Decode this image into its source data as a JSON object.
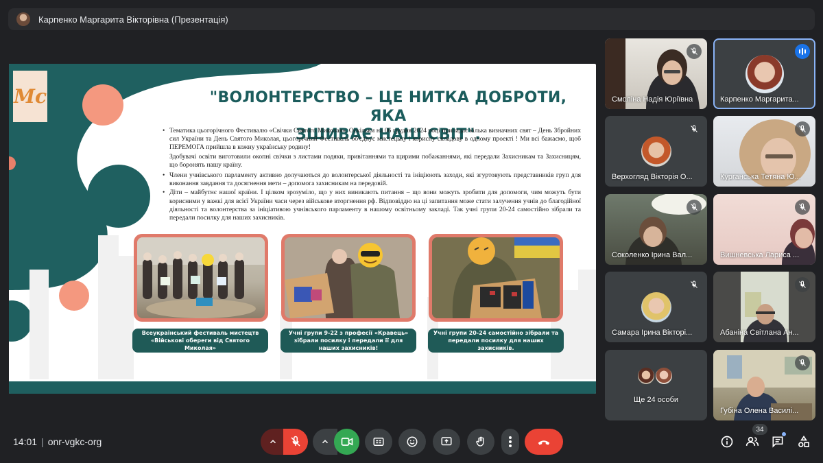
{
  "presenter_bar": {
    "title": "Карпенко Маргарита Вікторівна (Презентація)"
  },
  "slide": {
    "logo_text": "Mc",
    "title_line1": "\"ВОЛОНТЕРСТВО – ЦЕ НИТКА ДОБРОТИ, ЯКА",
    "title_line2": "ЗШИВАЄ НАШ СВІТ\".",
    "paragraphs": [
      "Тематика цьогорічного Фестивалю «Свічки Святого Миколая». Оскільки на 06 грудня 2024 році припадає кілька визначних свят – День Збройних сил України та День Святого Миколая, цьогорічний Фестиваль об'єднує мистецьку і корисну складову в одному проекті ! Ми всі бажаємо, щоб ПЕРЕМОГА прийшла в кожну українську родину!",
      "Здобувачі освіти виготовили окопні свічки з листами подяки, привітаннями та щирими побажаннями, які передали Захисникам та Захисницям, що боронять нашу країну.",
      "Члени учнівського парламенту активно долучаються до волонтерської діяльності та ініціюють заходи, які згуртовують представників груп для виконання завдання та досягнення мети – допомога захисникам на передовій.",
      "Діти – майбутнє нашої країни. І цілком зрозуміло, що у них виникають питання – що вони можуть зробити для допомоги, чим можуть бути корисними у важкі для всієї України часи через військове вторгнення рф. Відповіддю на ці запитання може стати залучення учнів до благодійної діяльності та волонтерства за ініціативою учнівського парламенту в нашому освітньому закладі. Так учні групи 20-24 самостійно зібрали та передали посилку для наших захисників."
    ],
    "captions": [
      "Всеукраїнський фестиваль мистецтв «Військові обереги від Святого Миколая»",
      "Учні групи 9-22 з професії «Кравець» зібрали посилку і передали її для наших захисників!",
      "Учні групи 20-24 самостійно зібрали та передали посилку для наших захисників."
    ]
  },
  "participants": [
    {
      "name": "Смоліна Надія Юріївна",
      "muted": true,
      "video": true
    },
    {
      "name": "Карпенко Маргарита...",
      "muted": false,
      "speaking": true,
      "video": false
    },
    {
      "name": "Верхогляд Вікторія О...",
      "muted": true,
      "video": false
    },
    {
      "name": "Курганська Тетяна Ю...",
      "muted": true,
      "video": true
    },
    {
      "name": "Соколенко Ірина Вал...",
      "muted": true,
      "video": true
    },
    {
      "name": "Вишневська Лариса ...",
      "muted": true,
      "video": true
    },
    {
      "name": "Самара Ірина Вікторі...",
      "muted": true,
      "video": false
    },
    {
      "name": "Абаніна Світлана Ан...",
      "muted": true,
      "video": true
    },
    {
      "name": "Ще 24 особи",
      "muted": false,
      "video": false
    },
    {
      "name": "Губіна Олена Василі...",
      "muted": true,
      "video": true
    }
  ],
  "bottom_bar": {
    "time": "14:01",
    "meeting_code": "onr-vgkc-org",
    "participants_count": "34",
    "icons": [
      "chevron-up-icon",
      "mic-off-icon",
      "chevron-up-icon",
      "camera-icon",
      "captions-icon",
      "emoji-icon",
      "present-icon",
      "raise-hand-icon",
      "more-icon",
      "end-call-icon",
      "info-icon",
      "people-icon",
      "chat-icon",
      "activities-icon"
    ]
  },
  "colors": {
    "background": "#202124",
    "slide_teal": "#1b5c5c",
    "slide_coral": "#f0907a",
    "active_border": "#8ab4f8",
    "end_call_red": "#ea4335",
    "camera_green": "#34a853"
  }
}
